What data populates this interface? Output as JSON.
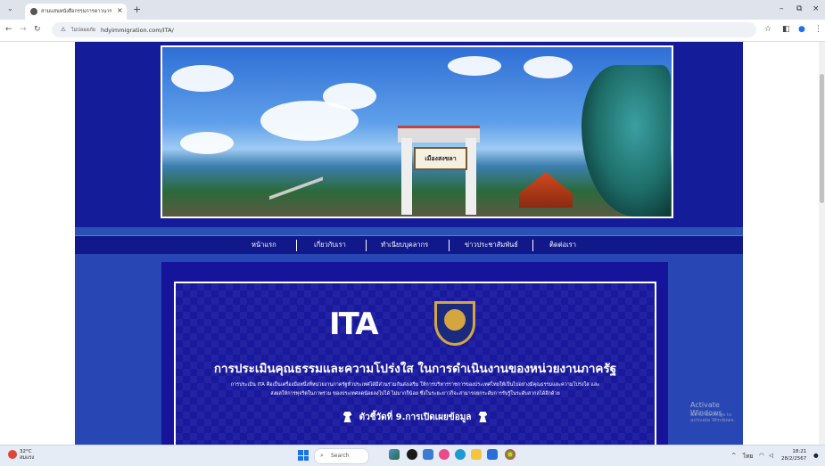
{
  "browser": {
    "tab_title": "สามแสนหนังสือกรรมการดาวนาร",
    "new_tab": "+",
    "tab_close": "×",
    "security_text": "ไม่ปลอดภัย",
    "url": "hdyimmigration.com/ITA/",
    "window_controls": [
      "–",
      "⧉",
      "×"
    ]
  },
  "site": {
    "banner_sign": "เมืองสงขลา",
    "menu": [
      "หน้าแรก",
      "เกี่ยวกับเรา",
      "ทำเนียบบุคลากร",
      "ข่าวประชาสัมพันธ์",
      "ติดต่อเรา"
    ],
    "ita_logo": "ITA",
    "headline": "การประเมินคุณธรรมและความโปร่งใส ในการดำเนินงานของหน่วยงานภาครัฐ",
    "description_line1": "การประเมิน ITA คือเป็นเครื่องมือหนึ่งที่หน่วยงานภาครัฐทั่วประเทศได้มีส่วนร่วมกันส่งเสริม ให้การบริหารราชการของประเทศไทยให้เป็นไปอย่างมีคุณธรรมและความโปร่งใส และ",
    "description_line2": "ส่งผลให้การทุจริตในภาพรวม ของประเทศลดน้อยลงไปได้ ไม่มากก็น้อย ซึ่งในระยะยาวก็จะสามารถยกระดับการรับรู้ในระดับสากลได้อีกด้วย",
    "indicator": "ตัวชี้วัดที่ 9.การเปิดเผยข้อมูล"
  },
  "watermark": {
    "line1": "Activate Windows",
    "line2": "Go to Settings to activate Windows."
  },
  "taskbar": {
    "weather_temp": "32°C",
    "weather_desc": "ลมแรง",
    "search_placeholder": "Search",
    "lang": "ไทย",
    "time": "18:21",
    "date": "28/2/2567"
  }
}
